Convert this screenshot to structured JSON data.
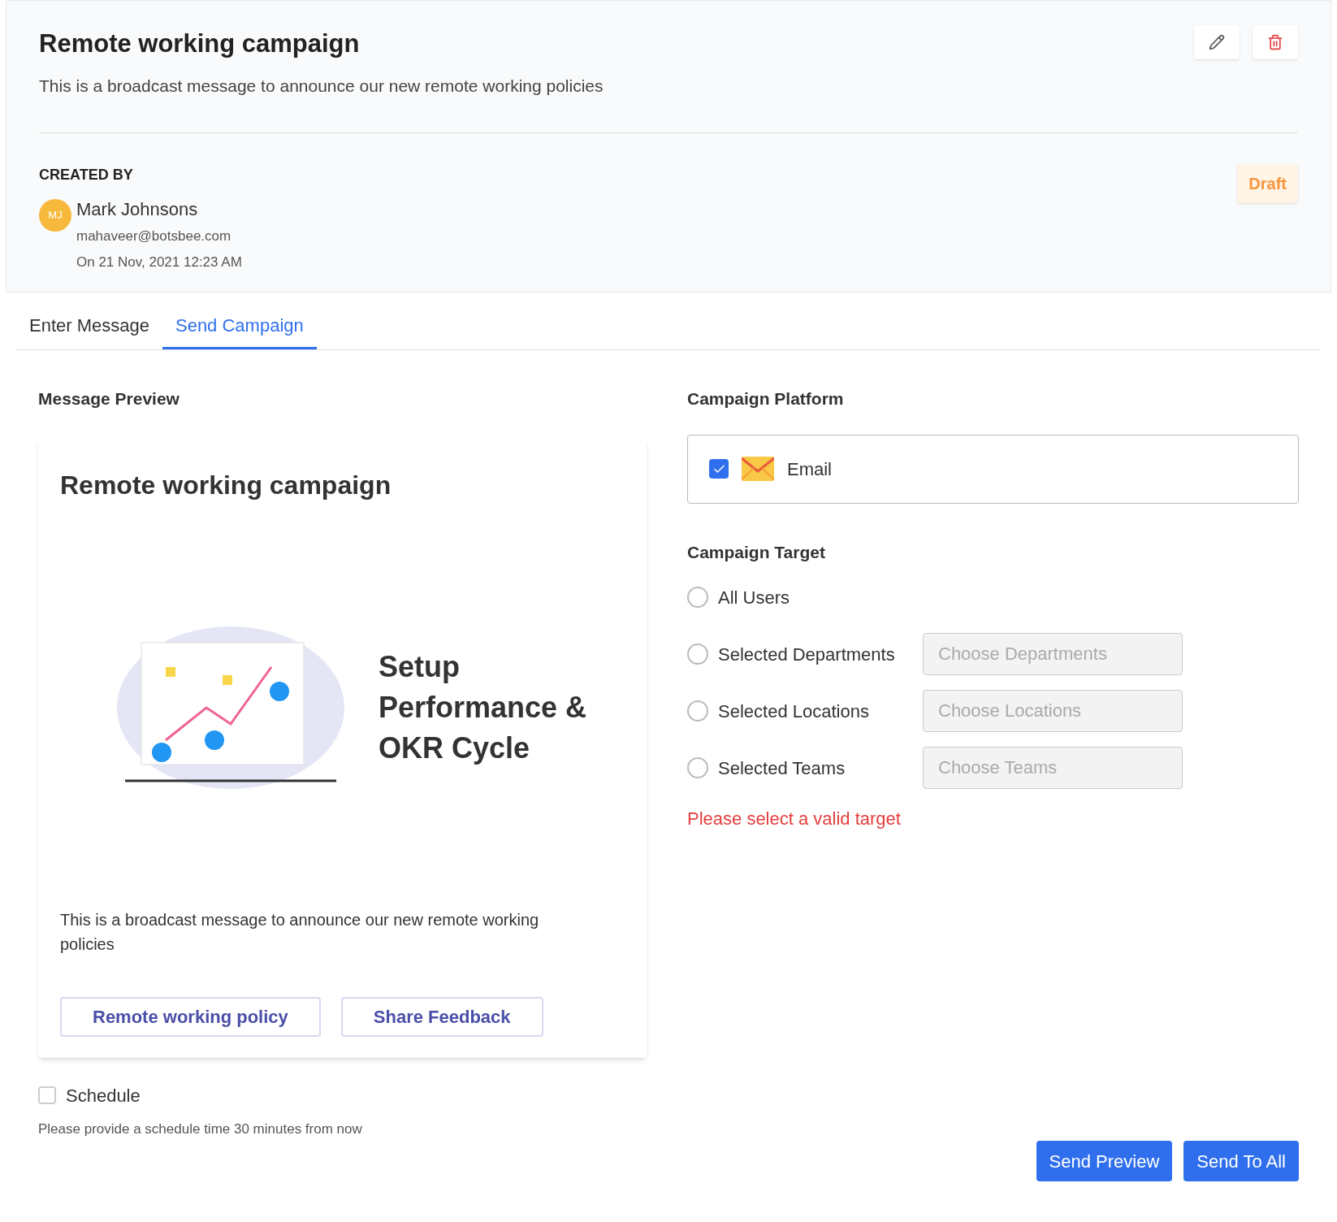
{
  "header": {
    "title": "Remote working campaign",
    "description": "This is a broadcast message to announce our new remote working policies",
    "created_by_label": "CREATED BY",
    "avatar_initials": "MJ",
    "author_name": "Mark Johnsons",
    "author_email": "mahaveer@botsbee.com",
    "created_on": "On 21 Nov, 2021 12:23 AM",
    "status": "Draft"
  },
  "tabs": [
    {
      "label": "Enter Message",
      "selected": false
    },
    {
      "label": "Send Campaign",
      "selected": true
    }
  ],
  "preview": {
    "heading": "Message Preview",
    "card_title": "Remote working campaign",
    "banner_title": [
      "Setup",
      "Performance &",
      "OKR Cycle"
    ],
    "body": "This is a broadcast message to announce our new remote working policies",
    "buttons": [
      "Remote working policy",
      "Share Feedback"
    ]
  },
  "schedule": {
    "label": "Schedule",
    "checked": false,
    "hint": "Please provide a schedule time 30 minutes from now"
  },
  "platform": {
    "heading": "Campaign Platform",
    "options": [
      {
        "label": "Email",
        "checked": true
      }
    ]
  },
  "target": {
    "heading": "Campaign Target",
    "options": [
      {
        "label": "All Users",
        "selected": false
      },
      {
        "label": "Selected Departments",
        "selected": false,
        "placeholder": "Choose Departments"
      },
      {
        "label": "Selected Locations",
        "selected": false,
        "placeholder": "Choose Locations"
      },
      {
        "label": "Selected Teams",
        "selected": false,
        "placeholder": "Choose Teams"
      }
    ],
    "error": "Please select a valid target"
  },
  "actions": [
    "Send Preview",
    "Send To All"
  ]
}
